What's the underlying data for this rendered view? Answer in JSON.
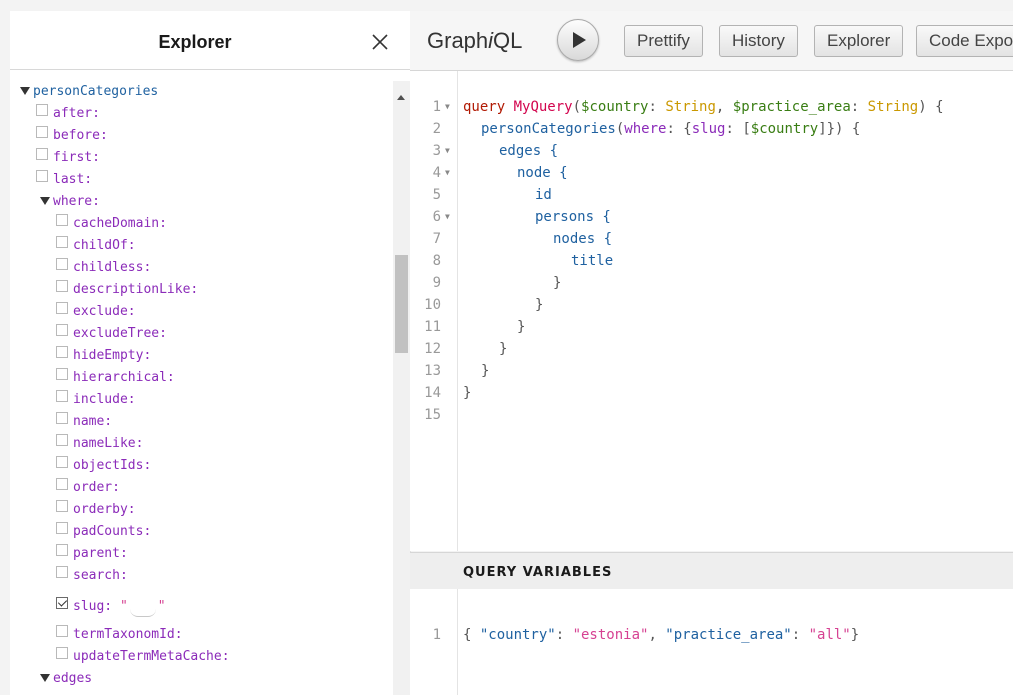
{
  "explorer": {
    "title": "Explorer",
    "close_icon": "close-icon",
    "root_field": "personCategories",
    "args": [
      "after:",
      "before:",
      "first:",
      "last:"
    ],
    "where_label": "where:",
    "where_args": [
      "cacheDomain:",
      "childOf:",
      "childless:",
      "descriptionLike:",
      "exclude:",
      "excludeTree:",
      "hideEmpty:",
      "hierarchical:",
      "include:",
      "name:",
      "nameLike:",
      "objectIds:",
      "order:",
      "orderby:",
      "padCounts:",
      "parent:",
      "search:"
    ],
    "slug_label": "slug:",
    "slug_value_open": "\"",
    "slug_value_close": "\"",
    "after_slug_args": [
      "termTaxonomId:",
      "updateTermMetaCache:"
    ],
    "edges_label": "edges"
  },
  "toolbar": {
    "logo_pre": "Graph",
    "logo_i": "i",
    "logo_post": "QL",
    "run_icon": "play-icon",
    "prettify": "Prettify",
    "history": "History",
    "explorer": "Explorer",
    "code_export": "Code Exporter"
  },
  "query": {
    "line_numbers": [
      "1",
      "2",
      "3",
      "4",
      "5",
      "6",
      "7",
      "8",
      "9",
      "10",
      "11",
      "12",
      "13",
      "14",
      "15"
    ],
    "l1": {
      "kw": "query",
      "name": "MyQuery",
      "p1": "(",
      "v1": "$country",
      "c1": ": ",
      "t1": "String",
      "sep": ", ",
      "v2": "$practice_area",
      "c2": ": ",
      "t2": "String",
      "end": ") {"
    },
    "l2": {
      "field": "personCategories",
      "p1": "(",
      "arg": "where",
      "p2": ": {",
      "arg2": "slug",
      "p3": ": [",
      "v": "$country",
      "end": "]}) {"
    },
    "l3": "edges {",
    "l4": "node {",
    "l5": "id",
    "l6": "persons {",
    "l7": "nodes {",
    "l8": "title",
    "close": "}"
  },
  "variables": {
    "title": "QUERY VARIABLES",
    "line_number": "1",
    "open": "{ ",
    "k1": "\"country\"",
    "colon": ": ",
    "v1": "\"estonia\"",
    "comma": ", ",
    "k2": "\"practice_area\"",
    "v2": "\"all\"",
    "close": "}"
  }
}
